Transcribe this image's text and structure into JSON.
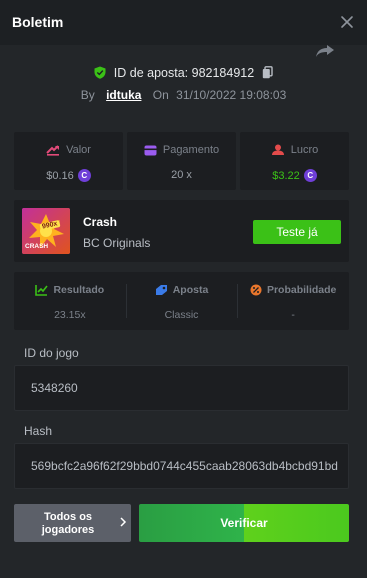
{
  "header": {
    "title": "Boletim"
  },
  "bet": {
    "id_label": "ID de aposta:",
    "id_value": "982184912",
    "by_label": "By",
    "username": "idtuka",
    "on_label": "On",
    "datetime": "31/10/2022 19:08:03"
  },
  "stats": {
    "amount": {
      "label": "Valor",
      "value": "$0.16"
    },
    "payout": {
      "label": "Pagamento",
      "value": "20 x"
    },
    "profit": {
      "label": "Lucro",
      "value": "$3.22"
    }
  },
  "game": {
    "thumb_badge": "990x",
    "thumb_text": "CRASH",
    "name": "Crash",
    "provider": "BC Originals",
    "try_label": "Teste já"
  },
  "result": {
    "outcome": {
      "label": "Resultado",
      "value": "23.15x"
    },
    "bet": {
      "label": "Aposta",
      "value": "Classic"
    },
    "probability": {
      "label": "Probabilidade",
      "value": "-"
    }
  },
  "game_id": {
    "label": "ID do jogo",
    "value": "5348260"
  },
  "hash": {
    "label": "Hash",
    "value": "569bcfc2a96f62f29bbd0744c455caab28063db4bcbd91bd"
  },
  "actions": {
    "all_players_line1": "Todos os",
    "all_players_line2": "jogadores",
    "verify_label": "Verificar"
  },
  "colors": {
    "background": "#232629",
    "card": "#1c1e21",
    "accent_green": "#3bc117",
    "coin_purple": "#6f3fd8",
    "loss_red": "#e34b4b"
  }
}
